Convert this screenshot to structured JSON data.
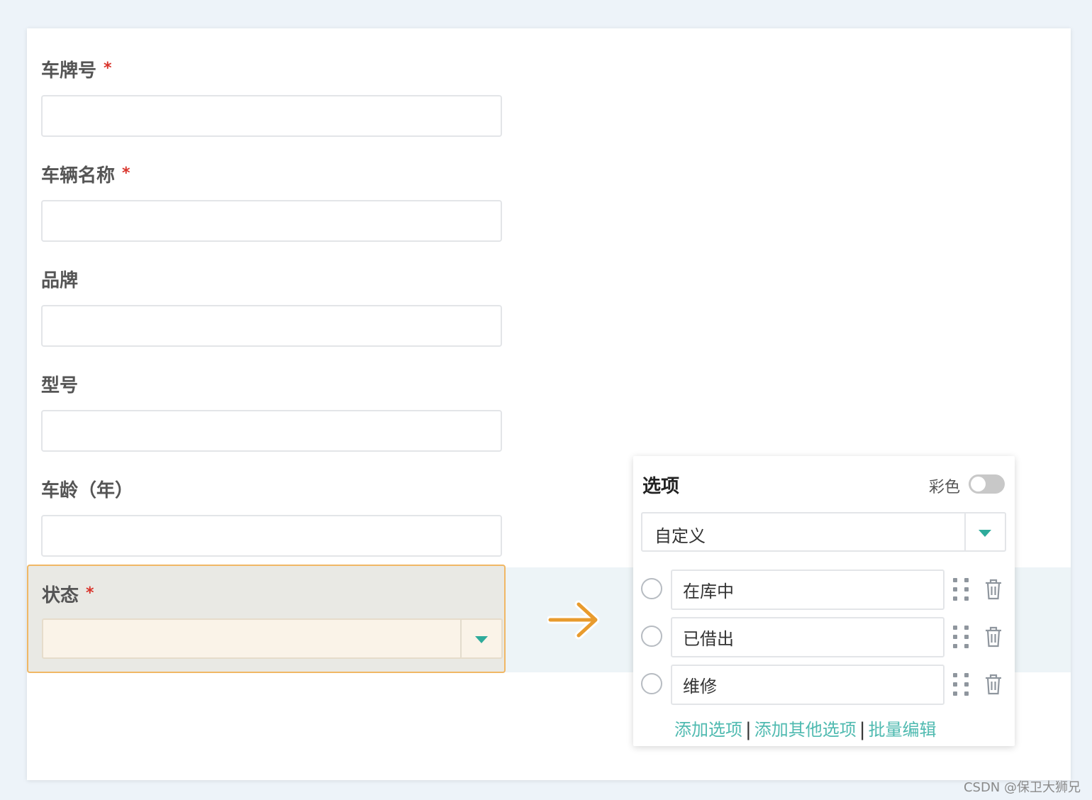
{
  "form": {
    "fields": [
      {
        "label": "车牌号",
        "required": true,
        "value": ""
      },
      {
        "label": "车辆名称",
        "required": true,
        "value": ""
      },
      {
        "label": "品牌",
        "required": false,
        "value": ""
      },
      {
        "label": "型号",
        "required": false,
        "value": ""
      },
      {
        "label": "车龄（年）",
        "required": false,
        "value": ""
      }
    ],
    "required_mark": "*",
    "status_field": {
      "label": "状态",
      "required": true,
      "value": ""
    }
  },
  "options_panel": {
    "title": "选项",
    "color_label": "彩色",
    "color_enabled": false,
    "type_value": "自定义",
    "options": [
      "在库中",
      "已借出",
      "维修"
    ],
    "links": {
      "add_option": "添加选项",
      "add_other": "添加其他选项",
      "batch_edit": "批量编辑"
    },
    "separator": "|"
  },
  "colors": {
    "accent": "#4fbab0",
    "caret": "#2eab9b",
    "arrow": "#e89b2d",
    "highlight_border": "#f0b765",
    "required": "#d9342b"
  },
  "icons": [
    "chevron-down-icon",
    "right-arrow-icon",
    "drag-handle-icon",
    "trash-icon"
  ],
  "watermark": "CSDN @保卫大狮兄"
}
